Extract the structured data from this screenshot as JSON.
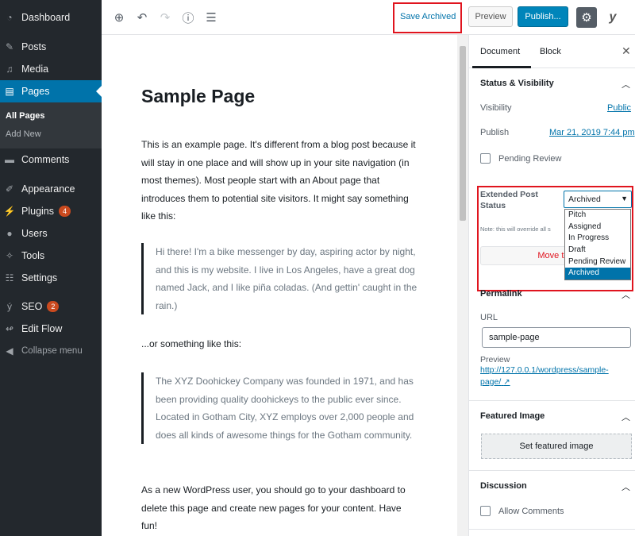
{
  "sidebar": {
    "items": [
      {
        "label": "Dashboard",
        "icon": "dashboard-icon"
      },
      {
        "label": "Posts",
        "icon": "pin-icon"
      },
      {
        "label": "Media",
        "icon": "media-icon"
      },
      {
        "label": "Pages",
        "icon": "pages-icon"
      },
      {
        "label": "Comments",
        "icon": "comment-icon"
      },
      {
        "label": "Appearance",
        "icon": "brush-icon"
      },
      {
        "label": "Plugins",
        "icon": "plugin-icon",
        "badge": "4"
      },
      {
        "label": "Users",
        "icon": "user-icon"
      },
      {
        "label": "Tools",
        "icon": "wrench-icon"
      },
      {
        "label": "Settings",
        "icon": "settings-icon"
      },
      {
        "label": "SEO",
        "icon": "yoast-icon",
        "badge": "2"
      },
      {
        "label": "Edit Flow",
        "icon": "editflow-icon"
      },
      {
        "label": "Collapse menu",
        "icon": "collapse-icon"
      }
    ],
    "submenu": [
      "All Pages",
      "Add New"
    ]
  },
  "toolbar": {
    "save_label": "Save Archived",
    "preview_label": "Preview",
    "publish_label": "Publish..."
  },
  "editor": {
    "title": "Sample Page",
    "para1": "This is an example page. It's different from a blog post because it will stay in one place and will show up in your site navigation (in most themes). Most people start with an About page that introduces them to potential site visitors. It might say something like this:",
    "quote1": "Hi there! I'm a bike messenger by day, aspiring actor by night, and this is my website. I live in Los Angeles, have a great dog named Jack, and I like piña coladas. (And gettin' caught in the rain.)",
    "para2": "...or something like this:",
    "quote2": "The XYZ Doohickey Company was founded in 1971, and has been providing quality doohickeys to the public ever since. Located in Gotham City, XYZ employs over 2,000 people and does all kinds of awesome things for the Gotham community.",
    "para3": "As a new WordPress user, you should go to your dashboard to delete this page and create new pages for your content. Have fun!"
  },
  "panel": {
    "tabs": [
      "Document",
      "Block"
    ],
    "status_visibility": {
      "heading": "Status & Visibility",
      "visibility_label": "Visibility",
      "visibility_value": "Public",
      "publish_label": "Publish",
      "publish_value": "Mar 21, 2019 7:44 pm",
      "pending_review": "Pending Review"
    },
    "extended_status": {
      "label": "Extended Post Status",
      "selected": "Archived",
      "options": [
        "Pitch",
        "Assigned",
        "In Progress",
        "Draft",
        "Pending Review",
        "Archived"
      ],
      "note": "Note: this will override all s",
      "move_btn": "Move to t"
    },
    "permalink": {
      "heading": "Permalink",
      "url_label": "URL",
      "url_value": "sample-page",
      "preview_label": "Preview",
      "preview_url": "http://127.0.0.1/wordpress/sample-page/"
    },
    "featured_image": {
      "heading": "Featured Image",
      "button": "Set featured image"
    },
    "discussion": {
      "heading": "Discussion",
      "allow_comments": "Allow Comments"
    }
  },
  "colors": {
    "sidebar_bg": "#23282d",
    "active_blue": "#0073aa",
    "highlight_red": "#e0141e",
    "badge": "#ca4a1f"
  }
}
